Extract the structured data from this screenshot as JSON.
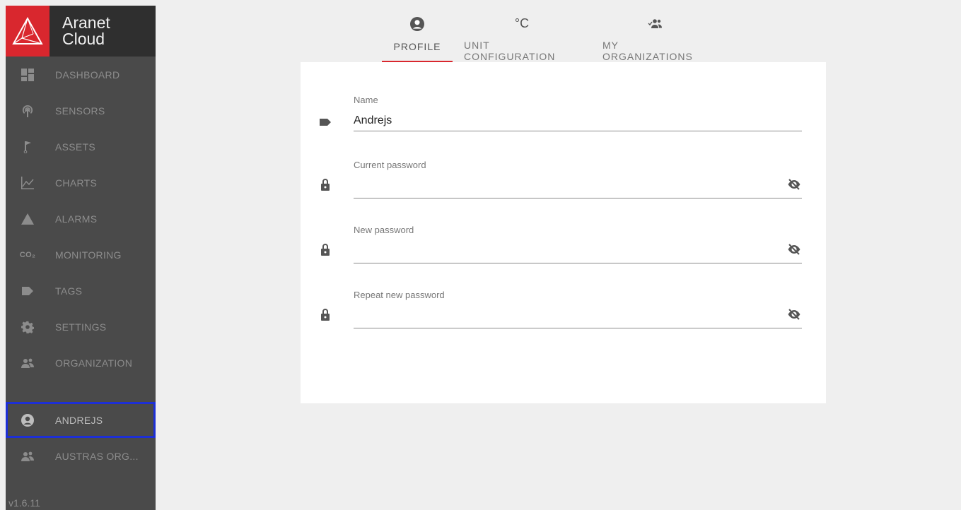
{
  "brand": {
    "line1": "Aranet",
    "line2": "Cloud",
    "color": "#d9272e"
  },
  "nav": [
    {
      "label": "DASHBOARD",
      "icon": "dashboard-icon"
    },
    {
      "label": "SENSORS",
      "icon": "sensor-icon"
    },
    {
      "label": "ASSETS",
      "icon": "flag-icon"
    },
    {
      "label": "CHARTS",
      "icon": "chart-icon"
    },
    {
      "label": "ALARMS",
      "icon": "warning-icon"
    },
    {
      "label": "MONITORING",
      "icon": "co2-icon"
    },
    {
      "label": "TAGS",
      "icon": "tag-icon"
    },
    {
      "label": "SETTINGS",
      "icon": "gear-icon"
    },
    {
      "label": "ORGANIZATION",
      "icon": "group-icon"
    }
  ],
  "user_nav": [
    {
      "label": "ANDREJS",
      "icon": "user-icon"
    },
    {
      "label": "AUSTRAS ORG...",
      "icon": "group-icon"
    }
  ],
  "version": "v1.6.11",
  "co2_icon_text": "CO₂",
  "tabs": {
    "profile": "PROFILE",
    "unit": "UNIT CONFIGURATION",
    "unit_icon": "°C",
    "orgs": "MY ORGANIZATIONS"
  },
  "form": {
    "name_label": "Name",
    "name_value": "Andrejs",
    "current_password_label": "Current password",
    "new_password_label": "New password",
    "repeat_password_label": "Repeat new password"
  }
}
